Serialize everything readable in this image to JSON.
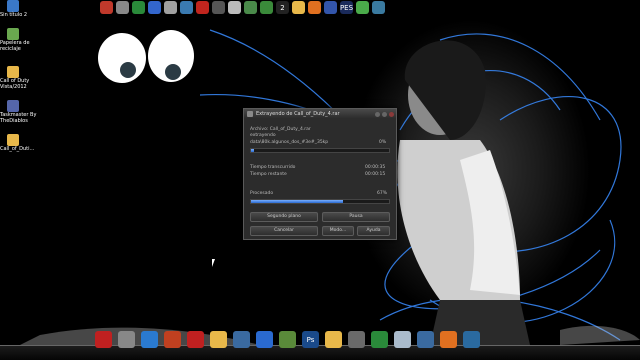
{
  "desktop_icons": [
    {
      "label": "Sin título 2",
      "icon": "document-icon",
      "color": "#3a78c8"
    },
    {
      "label": "Papelera de\nreciclaje",
      "icon": "recycle-bin-icon",
      "color": "#6aa84f"
    },
    {
      "label": "Call of Duty\nVista/2012",
      "icon": "folder-icon",
      "color": "#e8b84a"
    },
    {
      "label": "Taskmaster By\nTheDiablos",
      "icon": "app-icon",
      "color": "#5566aa"
    },
    {
      "label": "Call_of_Duti...",
      "icon": "folder-icon",
      "color": "#e8b84a"
    }
  ],
  "top_dock": [
    {
      "name": "lips-icon",
      "color": "#c0392b"
    },
    {
      "name": "clock-icon",
      "color": "#888888"
    },
    {
      "name": "chrome-icon",
      "color": "#2a8a3a"
    },
    {
      "name": "edit-icon",
      "color": "#3366cc"
    },
    {
      "name": "box-icon",
      "color": "#a0a0a0"
    },
    {
      "name": "globe-icon",
      "color": "#3a7ab0"
    },
    {
      "name": "acrobat-icon",
      "color": "#c0251e"
    },
    {
      "name": "drive-icon",
      "color": "#555555"
    },
    {
      "name": "file-icon",
      "color": "#bbbbbb"
    },
    {
      "name": "photo-icon",
      "color": "#4a8a4a"
    },
    {
      "name": "utorrent-icon",
      "color": "#3a8a3a"
    },
    {
      "name": "badge-2-icon",
      "color": "#222222",
      "text": "2"
    },
    {
      "name": "folder-icon",
      "color": "#e8b84a"
    },
    {
      "name": "orange-icon",
      "color": "#e07020"
    },
    {
      "name": "flag-icon",
      "color": "#3355aa"
    },
    {
      "name": "pes-icon",
      "color": "#1a2a5a",
      "text": "PES"
    },
    {
      "name": "recycle-icon",
      "color": "#4aaa4a"
    },
    {
      "name": "ring-icon",
      "color": "#3a7aa0"
    }
  ],
  "bottom_dock": [
    {
      "name": "nexus-icon",
      "color": "#c02020"
    },
    {
      "name": "tools-icon",
      "color": "#888888"
    },
    {
      "name": "windows-icon",
      "color": "#2a7ad0"
    },
    {
      "name": "paw-icon",
      "color": "#c04020"
    },
    {
      "name": "red-icon",
      "color": "#c02020"
    },
    {
      "name": "folder-icon",
      "color": "#e8b84a"
    },
    {
      "name": "disc-icon",
      "color": "#3a6aa0"
    },
    {
      "name": "lightning-icon",
      "color": "#2a6ad0"
    },
    {
      "name": "image-icon",
      "color": "#5a8a3a"
    },
    {
      "name": "photoshop-icon",
      "color": "#1a4a8a",
      "text": "Ps"
    },
    {
      "name": "folder2-icon",
      "color": "#e8b84a"
    },
    {
      "name": "picture-icon",
      "color": "#6a6a6a"
    },
    {
      "name": "chrome-icon",
      "color": "#2a8a3a"
    },
    {
      "name": "window-icon",
      "color": "#aabbcc"
    },
    {
      "name": "gear-icon",
      "color": "#3a6aa0"
    },
    {
      "name": "vlc-icon",
      "color": "#e07020"
    },
    {
      "name": "mail-icon",
      "color": "#2a6aa0"
    }
  ],
  "dialog": {
    "title": "Extrayendo de Call_of_Duty_4.rar",
    "archive_line": "Archivo: Call_of_Duty_4.rar",
    "status_line": "extrayendo",
    "file_line": "data\\80k.algunos_dos_#3e#_35kp",
    "file_percent": "0%",
    "elapsed_label": "Tiempo transcurrido",
    "elapsed_value": "00:00:35",
    "remaining_label": "Tiempo restante",
    "remaining_value": "00:00:15",
    "processed_label": "Procesado",
    "processed_value": "67%",
    "processed_fraction": 0.67,
    "file_fraction": 0.02,
    "buttons": {
      "background": "Segundo plano",
      "pause": "Pausa",
      "cancel": "Cancelar",
      "mode": "Modo...",
      "help": "Ayuda"
    }
  }
}
